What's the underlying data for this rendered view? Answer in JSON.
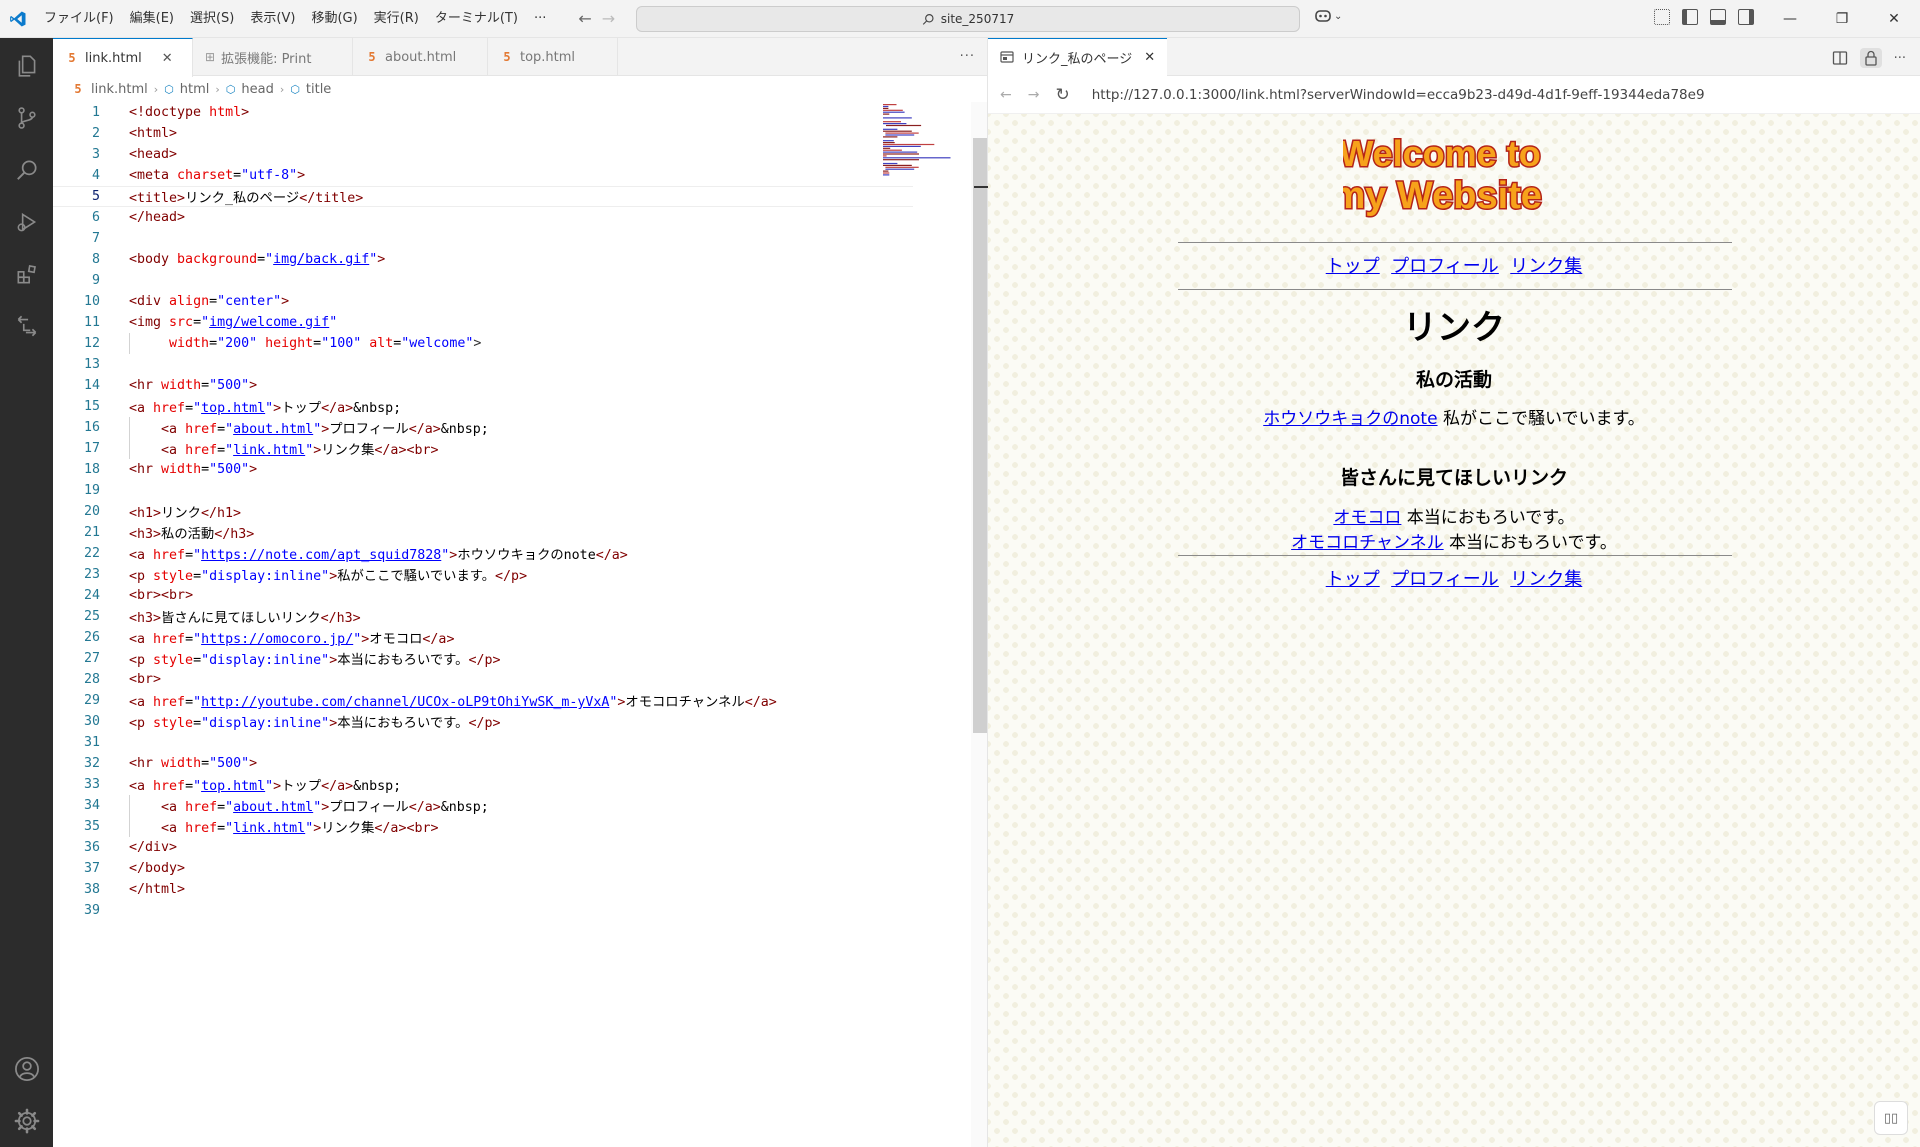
{
  "titlebar": {
    "menu": [
      "ファイル(F)",
      "編集(E)",
      "選択(S)",
      "表示(V)",
      "移動(G)",
      "実行(R)",
      "ターミナル(T)",
      "···"
    ],
    "search": "site_250717",
    "window_controls": [
      "—",
      "❐",
      "✕"
    ]
  },
  "editor": {
    "tabs": [
      {
        "label": "link.html",
        "icon": "html-file-icon",
        "active": true
      },
      {
        "label": "拡張機能: Print",
        "icon": "extensions-icon",
        "active": false
      },
      {
        "label": "about.html",
        "icon": "html-file-icon",
        "active": false
      },
      {
        "label": "top.html",
        "icon": "html-file-icon",
        "active": false
      }
    ],
    "tabs_more": "···",
    "close_glyph": "✕",
    "breadcrumb": [
      "link.html",
      "html",
      "head",
      "title"
    ],
    "current_line": 5,
    "lines": [
      "<!doctype html>",
      "<html>",
      "<head>",
      "<meta charset=\"utf-8\">",
      "<title>リンク_私のページ</title>",
      "</head>",
      "",
      "<body background=\"img/back.gif\">",
      "",
      "<div align=\"center\">",
      "<img src=\"img/welcome.gif\"",
      "     width=\"200\" height=\"100\" alt=\"welcome\">",
      "",
      "<hr width=\"500\">",
      "<a href=\"top.html\">トップ</a>&nbsp;",
      "    <a href=\"about.html\">プロフィール</a>&nbsp;",
      "    <a href=\"link.html\">リンク集</a><br>",
      "<hr width=\"500\">",
      "",
      "<h1>リンク</h1>",
      "<h3>私の活動</h3>",
      "<a href=\"https://note.com/apt_squid7828\">ホウソウキョクのnote</a>",
      "<p style=\"display:inline\">私がここで騒いでいます。</p>",
      "<br><br>",
      "<h3>皆さんに見てほしいリンク</h3>",
      "<a href=\"https://omocoro.jp/\">オモコロ</a>",
      "<p style=\"display:inline\">本当におもろいです。</p>",
      "<br>",
      "<a href=\"http://youtube.com/channel/UCOx-oLP9tOhiYwSK_m-yVxA\">オモコロチャンネル</a>",
      "<p style=\"display:inline\">本当におもろいです。</p>",
      "",
      "<hr width=\"500\">",
      "<a href=\"top.html\">トップ</a>&nbsp;",
      "    <a href=\"about.html\">プロフィール</a>&nbsp;",
      "    <a href=\"link.html\">リンク集</a><br>",
      "</div>",
      "</body>",
      "</html>",
      ""
    ]
  },
  "preview": {
    "tab_title": "リンク_私のページ",
    "url": "http://127.0.0.1:3000/link.html?serverWindowId=ecca9b23-d49d-4d1f-9eff-19344eda78e9",
    "page": {
      "logo_line1": "Welcome to",
      "logo_line2": "my Website!",
      "nav": [
        "トップ",
        "プロフィール",
        "リンク集"
      ],
      "h1": "リンク",
      "section1_title": "私の活動",
      "section1_link": "ホウソウキョクのnote",
      "section1_text": " 私がここで騒いでいます。",
      "section2_title": "皆さんに見てほしいリンク",
      "link2": "オモコロ",
      "link2_text": " 本当におもろいです。",
      "link3": "オモコロチャンネル",
      "link3_text": " 本当におもろいです。"
    }
  },
  "colors": {
    "accent": "#007acc",
    "activity_bar": "#2c2c2c",
    "link": "#0000ee",
    "tag": "#800000",
    "attribute": "#e50000",
    "string": "#0000ff"
  }
}
